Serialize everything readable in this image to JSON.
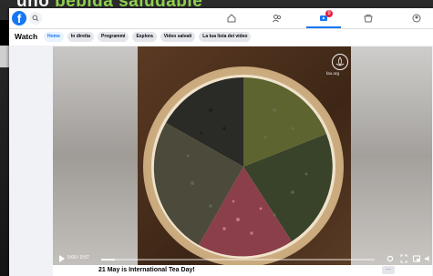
{
  "backdrop": {
    "text_part1": "uno ",
    "text_part2": "bebida saludable"
  },
  "topbar": {
    "logo_letter": "f",
    "notification_count": "9"
  },
  "watch": {
    "title": "Watch",
    "chips": [
      "Home",
      "In diretta",
      "Programmi",
      "Esplora",
      "Video salvati",
      "La tua lista dei video"
    ],
    "active_chip": "Home"
  },
  "video": {
    "overlay_logo": "FAO",
    "overlay_label": "fao.org",
    "time": "0:00 / 0:57",
    "progress": 0.05
  },
  "caption": {
    "text": "21 May is International Tea Day!",
    "more_label": "···"
  }
}
